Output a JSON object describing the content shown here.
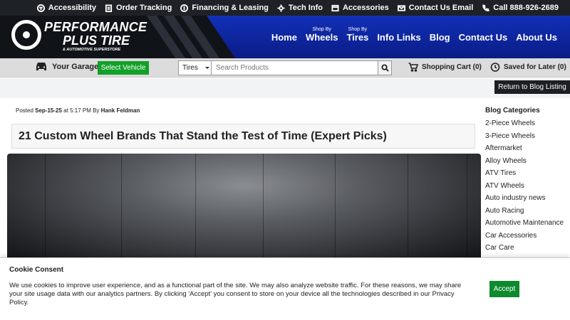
{
  "utility_bar": {
    "items": [
      {
        "label": "Accessibility"
      },
      {
        "label": "Order Tracking"
      },
      {
        "label": "Financing & Leasing"
      },
      {
        "label": "Tech Info"
      },
      {
        "label": "Accessories"
      },
      {
        "label": "Contact Us Email"
      },
      {
        "label": "Call 888-926-2689"
      }
    ]
  },
  "logo": {
    "line1": "PERFORMANCE",
    "line2": "PLUS TIRE",
    "line3": "& AUTOMOTIVE SUPERSTORE"
  },
  "nav": {
    "home": "Home",
    "wheels_sub": "Shop By",
    "wheels": "Wheels",
    "tires_sub": "Shop By",
    "tires": "Tires",
    "info_links": "Info Links",
    "blog": "Blog",
    "contact": "Contact Us",
    "about": "About Us"
  },
  "toolbar": {
    "garage_label": "Your Garage",
    "select_vehicle": "Select Vehicle",
    "search_category": "Tires",
    "search_placeholder": "Search Products",
    "cart_label": "Shopping Cart (0)",
    "saved_label": "Saved for Later (0)"
  },
  "blog_listing": {
    "return_label": "Return to Blog Listing"
  },
  "article": {
    "posted_prefix": "Posted",
    "posted_date": "Sep-15-25",
    "posted_time": "at 5:17 PM By",
    "author": "Hank Feldman",
    "title": "21 Custom Wheel Brands That Stand the Test of Time (Expert Picks)"
  },
  "sidebar": {
    "title": "Blog Categories",
    "categories": [
      "2-Piece Wheels",
      "3-Piece Wheels",
      "Aftermarket",
      "Alloy Wheels",
      "ATV Tires",
      "ATV Wheels",
      "Auto industry news",
      "Auto Racing",
      "Automotive Maintenance",
      "Car Accessories",
      "Car Care"
    ]
  },
  "cookie": {
    "title": "Cookie Consent",
    "text": "We use cookies to improve user experience, and as a functional part of the site. We may also analyze website traffic. For these reasons, we may share your site usage data with our analytics partners. By clicking 'Accept' you consent to store on your device all the technologies described in our Privacy Policy.",
    "accept_label": "Accept"
  },
  "colors": {
    "header_dark": "#101318",
    "header_blue": "#0a1c86",
    "select_vehicle_green": "#11a028",
    "accept_green": "#0d8a2e",
    "return_button": "#1c1f23"
  }
}
